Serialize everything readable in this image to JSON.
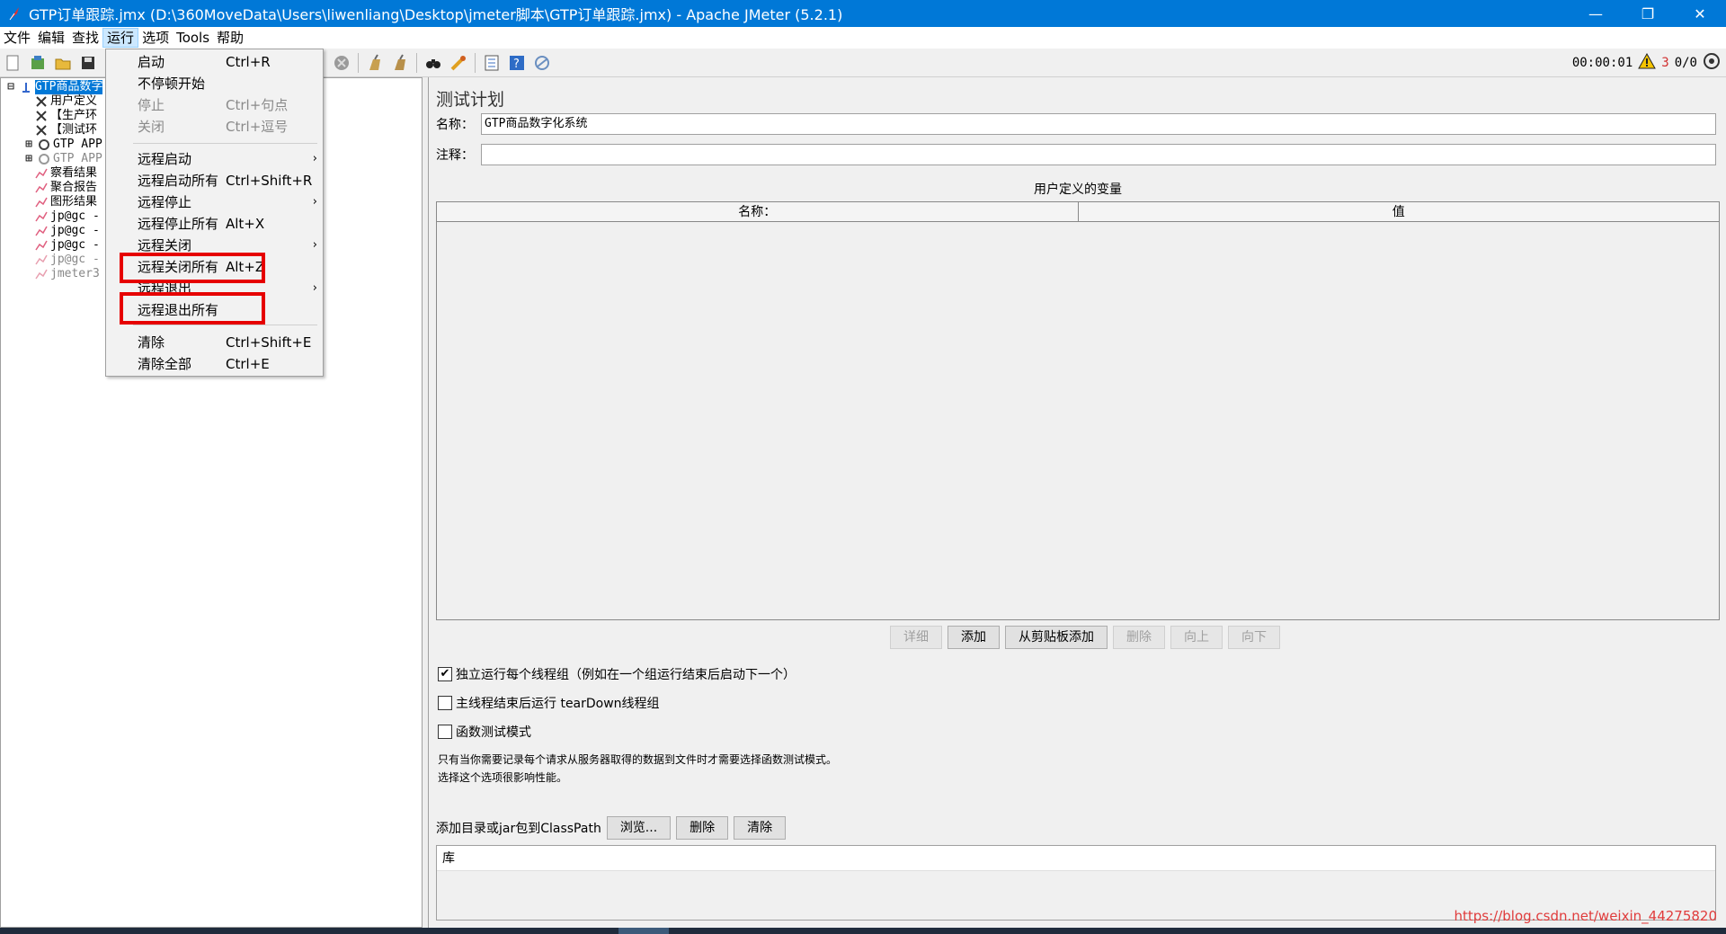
{
  "window": {
    "title": "GTP订单跟踪.jmx (D:\\360MoveData\\Users\\liwenliang\\Desktop\\jmeter脚本\\GTP订单跟踪.jmx) - Apache JMeter (5.2.1)",
    "minimize": "—",
    "maximize": "❐",
    "close": "✕"
  },
  "menubar": [
    "文件",
    "编辑",
    "查找",
    "运行",
    "选项",
    "Tools",
    "帮助"
  ],
  "toolbar": {
    "elapsed": "00:00:01",
    "warning_count": "3",
    "threads": "0/0"
  },
  "run_menu": {
    "items": [
      {
        "label": "启动",
        "shortcut": "Ctrl+R",
        "enabled": true,
        "submenu": false
      },
      {
        "label": "不停顿开始",
        "shortcut": "",
        "enabled": true,
        "submenu": false
      },
      {
        "label": "停止",
        "shortcut": "Ctrl+句点",
        "enabled": false,
        "submenu": false
      },
      {
        "label": "关闭",
        "shortcut": "Ctrl+逗号",
        "enabled": false,
        "submenu": false
      },
      {
        "label": "远程启动",
        "shortcut": "",
        "enabled": true,
        "submenu": true
      },
      {
        "label": "远程启动所有",
        "shortcut": "Ctrl+Shift+R",
        "enabled": true,
        "submenu": false
      },
      {
        "label": "远程停止",
        "shortcut": "",
        "enabled": true,
        "submenu": true
      },
      {
        "label": "远程停止所有",
        "shortcut": "Alt+X",
        "enabled": true,
        "submenu": false
      },
      {
        "label": "远程关闭",
        "shortcut": "",
        "enabled": true,
        "submenu": true
      },
      {
        "label": "远程关闭所有",
        "shortcut": "Alt+Z",
        "enabled": true,
        "submenu": false
      },
      {
        "label": "远程退出",
        "shortcut": "",
        "enabled": true,
        "submenu": true
      },
      {
        "label": "远程退出所有",
        "shortcut": "",
        "enabled": true,
        "submenu": false
      },
      {
        "label": "清除",
        "shortcut": "Ctrl+Shift+E",
        "enabled": true,
        "submenu": false
      },
      {
        "label": "清除全部",
        "shortcut": "Ctrl+E",
        "enabled": true,
        "submenu": false
      }
    ],
    "arrow": "›"
  },
  "tree": [
    {
      "label": "GTP商品数字",
      "icon": "test-plan-icon",
      "selected": true,
      "dim": false
    },
    {
      "label": "用户定义",
      "icon": "wrench-icon",
      "selected": false,
      "dim": false
    },
    {
      "label": "【生产环",
      "icon": "wrench-icon",
      "selected": false,
      "dim": false
    },
    {
      "label": "【测试环",
      "icon": "wrench-icon",
      "selected": false,
      "dim": false
    },
    {
      "label": "GTP APP",
      "icon": "thread-group-icon",
      "selected": false,
      "dim": false
    },
    {
      "label": "GTP APP",
      "icon": "thread-group-icon",
      "selected": false,
      "dim": true
    },
    {
      "label": "察看结果",
      "icon": "listener-icon",
      "selected": false,
      "dim": false
    },
    {
      "label": "聚合报告",
      "icon": "listener-icon",
      "selected": false,
      "dim": false
    },
    {
      "label": "图形结果",
      "icon": "listener-icon",
      "selected": false,
      "dim": false
    },
    {
      "label": "jp@gc -",
      "icon": "listener-icon",
      "selected": false,
      "dim": false
    },
    {
      "label": "jp@gc -",
      "icon": "listener-icon",
      "selected": false,
      "dim": false
    },
    {
      "label": "jp@gc -",
      "icon": "listener-icon",
      "selected": false,
      "dim": false
    },
    {
      "label": "jp@gc -",
      "icon": "listener-icon",
      "selected": false,
      "dim": true
    },
    {
      "label": "jmeter3",
      "icon": "listener-icon",
      "selected": false,
      "dim": true
    }
  ],
  "test_plan": {
    "panel_title": "测试计划",
    "name_label": "名称：",
    "name_value": "GTP商品数字化系统",
    "comment_label": "注释：",
    "comment_value": "",
    "vars_title": "用户定义的变量",
    "col_name": "名称：",
    "col_value": "值",
    "buttons": {
      "detail": "详细",
      "add": "添加",
      "add_clipboard": "从剪贴板添加",
      "delete": "删除",
      "up": "向上",
      "down": "向下"
    },
    "chk_serialize": "独立运行每个线程组（例如在一个组运行结束后启动下一个）",
    "chk_serialize_checked": true,
    "chk_teardown": "主线程结束后运行 tearDown线程组",
    "chk_teardown_checked": false,
    "chk_functional": "函数测试模式",
    "chk_functional_checked": false,
    "note_line1": "只有当你需要记录每个请求从服务器取得的数据到文件时才需要选择函数测试模式。",
    "note_line2": "选择这个选项很影响性能。",
    "classpath_label": "添加目录或jar包到ClassPath",
    "browse": "浏览...",
    "cp_delete": "删除",
    "cp_clear": "清除",
    "lib_header": "库"
  },
  "watermark": "https://blog.csdn.net/weixin_44275820",
  "colors": {
    "titlebar": "#0078d7",
    "highlight": "#e60000",
    "selection": "#0078d7"
  }
}
